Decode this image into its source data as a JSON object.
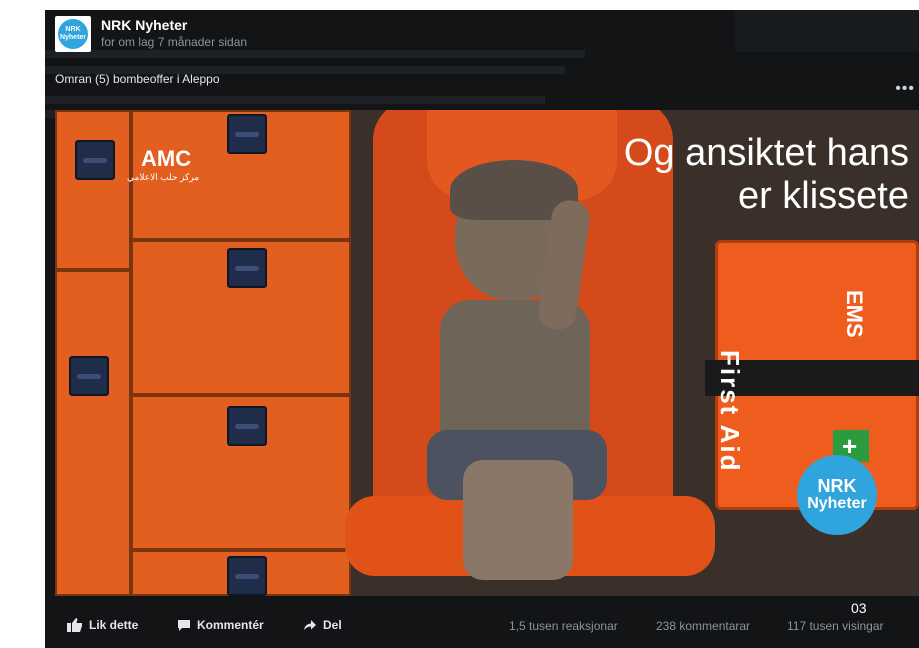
{
  "post": {
    "page_name": "NRK Nyheter",
    "avatar_text": [
      "NRK",
      "Nyheter"
    ],
    "time": "for om lag 7 månader sidan",
    "caption": "Omran (5) bombeoffer i Aleppo",
    "more_menu": "•••"
  },
  "video": {
    "overlay_caption_line1": "Og ansiktet hans",
    "overlay_caption_line2": "er klissete",
    "watermark_amc": "AMC",
    "watermark_arabic": "مركز حلب الاعلامي",
    "first_aid_label": "First Aid",
    "ems_label": "EMS",
    "badge_line1": "NRK",
    "badge_line2": "Nyheter",
    "timestamp": "03"
  },
  "actions": {
    "like": "Lik dette",
    "comment": "Kommentér",
    "share": "Del"
  },
  "stats": {
    "reactions": "1,5 tusen reaksjonar",
    "comments": "238 kommentarar",
    "views": "117 tusen visingar"
  },
  "colors": {
    "panel_bg": "#121416",
    "brand": "#2fa4dd",
    "muted_text": "#8d949e"
  }
}
